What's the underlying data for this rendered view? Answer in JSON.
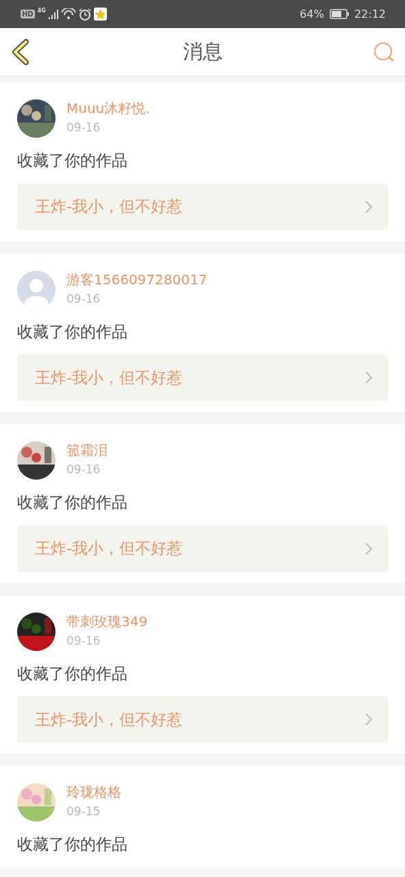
{
  "status_bar": {
    "hd_label": "HD",
    "network": "4G",
    "battery": "64%",
    "time": "22:12"
  },
  "header": {
    "title": "消息"
  },
  "messages": [
    {
      "user": "Muuu沐籽悦.",
      "date": "09-16",
      "action": "收藏了你的作品",
      "work": "王炸-我小，但不好惹",
      "default_avatar": false
    },
    {
      "user": "游客1566097280017",
      "date": "09-16",
      "action": "收藏了你的作品",
      "work": "王炸-我小，但不好惹",
      "default_avatar": true
    },
    {
      "user": "箛霜泪",
      "date": "09-16",
      "action": "收藏了你的作品",
      "work": "王炸-我小，但不好惹",
      "default_avatar": false
    },
    {
      "user": "带刺玫瑰349",
      "date": "09-16",
      "action": "收藏了你的作品",
      "work": "王炸-我小，但不好惹",
      "default_avatar": false
    },
    {
      "user": "玲珑格格",
      "date": "09-15",
      "action": "收藏了你的作品",
      "default_avatar": false
    }
  ]
}
